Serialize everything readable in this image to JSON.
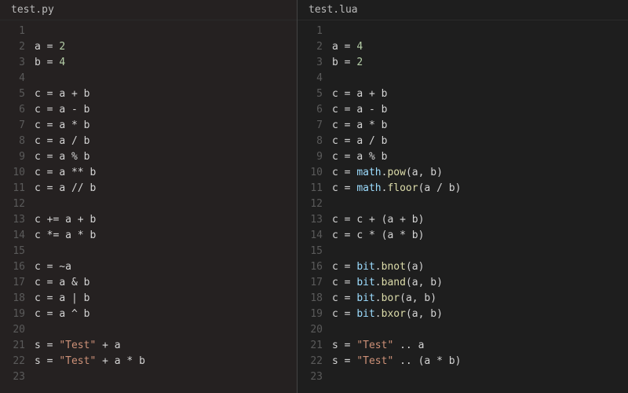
{
  "left": {
    "filename": "test.py",
    "lines": [
      [],
      [
        [
          "id",
          "a"
        ],
        [
          "op",
          " = "
        ],
        [
          "num",
          "2"
        ]
      ],
      [
        [
          "id",
          "b"
        ],
        [
          "op",
          " = "
        ],
        [
          "num",
          "4"
        ]
      ],
      [],
      [
        [
          "id",
          "c"
        ],
        [
          "op",
          " = "
        ],
        [
          "id",
          "a"
        ],
        [
          "op",
          " + "
        ],
        [
          "id",
          "b"
        ]
      ],
      [
        [
          "id",
          "c"
        ],
        [
          "op",
          " = "
        ],
        [
          "id",
          "a"
        ],
        [
          "op",
          " - "
        ],
        [
          "id",
          "b"
        ]
      ],
      [
        [
          "id",
          "c"
        ],
        [
          "op",
          " = "
        ],
        [
          "id",
          "a"
        ],
        [
          "op",
          " * "
        ],
        [
          "id",
          "b"
        ]
      ],
      [
        [
          "id",
          "c"
        ],
        [
          "op",
          " = "
        ],
        [
          "id",
          "a"
        ],
        [
          "op",
          " / "
        ],
        [
          "id",
          "b"
        ]
      ],
      [
        [
          "id",
          "c"
        ],
        [
          "op",
          " = "
        ],
        [
          "id",
          "a"
        ],
        [
          "op",
          " % "
        ],
        [
          "id",
          "b"
        ]
      ],
      [
        [
          "id",
          "c"
        ],
        [
          "op",
          " = "
        ],
        [
          "id",
          "a"
        ],
        [
          "op",
          " ** "
        ],
        [
          "id",
          "b"
        ]
      ],
      [
        [
          "id",
          "c"
        ],
        [
          "op",
          " = "
        ],
        [
          "id",
          "a"
        ],
        [
          "op",
          " // "
        ],
        [
          "id",
          "b"
        ]
      ],
      [],
      [
        [
          "id",
          "c"
        ],
        [
          "op",
          " += "
        ],
        [
          "id",
          "a"
        ],
        [
          "op",
          " + "
        ],
        [
          "id",
          "b"
        ]
      ],
      [
        [
          "id",
          "c"
        ],
        [
          "op",
          " *= "
        ],
        [
          "id",
          "a"
        ],
        [
          "op",
          " * "
        ],
        [
          "id",
          "b"
        ]
      ],
      [],
      [
        [
          "id",
          "c"
        ],
        [
          "op",
          " = ~"
        ],
        [
          "id",
          "a"
        ]
      ],
      [
        [
          "id",
          "c"
        ],
        [
          "op",
          " = "
        ],
        [
          "id",
          "a"
        ],
        [
          "op",
          " & "
        ],
        [
          "id",
          "b"
        ]
      ],
      [
        [
          "id",
          "c"
        ],
        [
          "op",
          " = "
        ],
        [
          "id",
          "a"
        ],
        [
          "op",
          " | "
        ],
        [
          "id",
          "b"
        ]
      ],
      [
        [
          "id",
          "c"
        ],
        [
          "op",
          " = "
        ],
        [
          "id",
          "a"
        ],
        [
          "op",
          " ^ "
        ],
        [
          "id",
          "b"
        ]
      ],
      [],
      [
        [
          "id",
          "s"
        ],
        [
          "op",
          " = "
        ],
        [
          "str",
          "\"Test\""
        ],
        [
          "op",
          " + "
        ],
        [
          "id",
          "a"
        ]
      ],
      [
        [
          "id",
          "s"
        ],
        [
          "op",
          " = "
        ],
        [
          "str",
          "\"Test\""
        ],
        [
          "op",
          " + "
        ],
        [
          "id",
          "a"
        ],
        [
          "op",
          " * "
        ],
        [
          "id",
          "b"
        ]
      ],
      []
    ]
  },
  "right": {
    "filename": "test.lua",
    "lines": [
      [],
      [
        [
          "id",
          "a"
        ],
        [
          "op",
          " = "
        ],
        [
          "num",
          "4"
        ]
      ],
      [
        [
          "id",
          "b"
        ],
        [
          "op",
          " = "
        ],
        [
          "num",
          "2"
        ]
      ],
      [],
      [
        [
          "id",
          "c"
        ],
        [
          "op",
          " = "
        ],
        [
          "id",
          "a"
        ],
        [
          "op",
          " + "
        ],
        [
          "id",
          "b"
        ]
      ],
      [
        [
          "id",
          "c"
        ],
        [
          "op",
          " = "
        ],
        [
          "id",
          "a"
        ],
        [
          "op",
          " - "
        ],
        [
          "id",
          "b"
        ]
      ],
      [
        [
          "id",
          "c"
        ],
        [
          "op",
          " = "
        ],
        [
          "id",
          "a"
        ],
        [
          "op",
          " * "
        ],
        [
          "id",
          "b"
        ]
      ],
      [
        [
          "id",
          "c"
        ],
        [
          "op",
          " = "
        ],
        [
          "id",
          "a"
        ],
        [
          "op",
          " / "
        ],
        [
          "id",
          "b"
        ]
      ],
      [
        [
          "id",
          "c"
        ],
        [
          "op",
          " = "
        ],
        [
          "id",
          "a"
        ],
        [
          "op",
          " % "
        ],
        [
          "id",
          "b"
        ]
      ],
      [
        [
          "id",
          "c"
        ],
        [
          "op",
          " = "
        ],
        [
          "obj",
          "math"
        ],
        [
          "op",
          "."
        ],
        [
          "fn",
          "pow"
        ],
        [
          "op",
          "("
        ],
        [
          "id",
          "a"
        ],
        [
          "op",
          ", "
        ],
        [
          "id",
          "b"
        ],
        [
          "op",
          ")"
        ]
      ],
      [
        [
          "id",
          "c"
        ],
        [
          "op",
          " = "
        ],
        [
          "obj",
          "math"
        ],
        [
          "op",
          "."
        ],
        [
          "fn",
          "floor"
        ],
        [
          "op",
          "("
        ],
        [
          "id",
          "a"
        ],
        [
          "op",
          " / "
        ],
        [
          "id",
          "b"
        ],
        [
          "op",
          ")"
        ]
      ],
      [],
      [
        [
          "id",
          "c"
        ],
        [
          "op",
          " = "
        ],
        [
          "id",
          "c"
        ],
        [
          "op",
          " + ("
        ],
        [
          "id",
          "a"
        ],
        [
          "op",
          " + "
        ],
        [
          "id",
          "b"
        ],
        [
          "op",
          ")"
        ]
      ],
      [
        [
          "id",
          "c"
        ],
        [
          "op",
          " = "
        ],
        [
          "id",
          "c"
        ],
        [
          "op",
          " * ("
        ],
        [
          "id",
          "a"
        ],
        [
          "op",
          " * "
        ],
        [
          "id",
          "b"
        ],
        [
          "op",
          ")"
        ]
      ],
      [],
      [
        [
          "id",
          "c"
        ],
        [
          "op",
          " = "
        ],
        [
          "obj",
          "bit"
        ],
        [
          "op",
          "."
        ],
        [
          "fn",
          "bnot"
        ],
        [
          "op",
          "("
        ],
        [
          "id",
          "a"
        ],
        [
          "op",
          ")"
        ]
      ],
      [
        [
          "id",
          "c"
        ],
        [
          "op",
          " = "
        ],
        [
          "obj",
          "bit"
        ],
        [
          "op",
          "."
        ],
        [
          "fn",
          "band"
        ],
        [
          "op",
          "("
        ],
        [
          "id",
          "a"
        ],
        [
          "op",
          ", "
        ],
        [
          "id",
          "b"
        ],
        [
          "op",
          ")"
        ]
      ],
      [
        [
          "id",
          "c"
        ],
        [
          "op",
          " = "
        ],
        [
          "obj",
          "bit"
        ],
        [
          "op",
          "."
        ],
        [
          "fn",
          "bor"
        ],
        [
          "op",
          "("
        ],
        [
          "id",
          "a"
        ],
        [
          "op",
          ", "
        ],
        [
          "id",
          "b"
        ],
        [
          "op",
          ")"
        ]
      ],
      [
        [
          "id",
          "c"
        ],
        [
          "op",
          " = "
        ],
        [
          "obj",
          "bit"
        ],
        [
          "op",
          "."
        ],
        [
          "fn",
          "bxor"
        ],
        [
          "op",
          "("
        ],
        [
          "id",
          "a"
        ],
        [
          "op",
          ", "
        ],
        [
          "id",
          "b"
        ],
        [
          "op",
          ")"
        ]
      ],
      [],
      [
        [
          "id",
          "s"
        ],
        [
          "op",
          " = "
        ],
        [
          "str",
          "\"Test\""
        ],
        [
          "op",
          " .. "
        ],
        [
          "id",
          "a"
        ]
      ],
      [
        [
          "id",
          "s"
        ],
        [
          "op",
          " = "
        ],
        [
          "str",
          "\"Test\""
        ],
        [
          "op",
          " .. ("
        ],
        [
          "id",
          "a"
        ],
        [
          "op",
          " * "
        ],
        [
          "id",
          "b"
        ],
        [
          "op",
          ")"
        ]
      ],
      []
    ]
  }
}
